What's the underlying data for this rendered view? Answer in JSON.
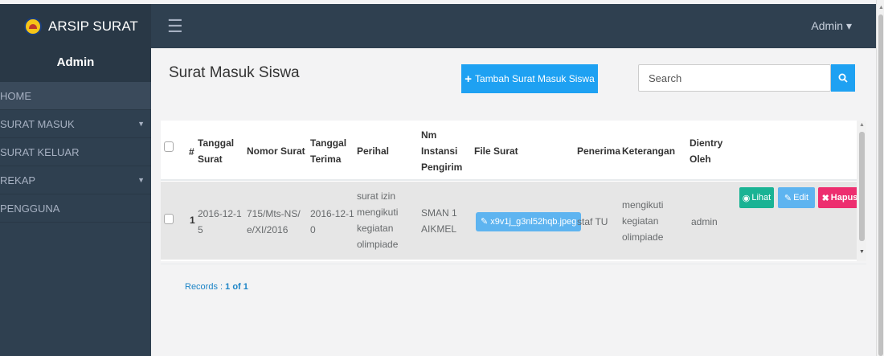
{
  "app": {
    "brand": "ARSIP SURAT",
    "user_menu": "Admin ▾"
  },
  "sidebar": {
    "header": "Admin",
    "items": [
      {
        "label": "HOME"
      },
      {
        "label": "SURAT MASUK"
      },
      {
        "label": "SURAT KELUAR"
      },
      {
        "label": "REKAP"
      },
      {
        "label": "PENGGUNA"
      }
    ]
  },
  "page": {
    "title": "Surat Masuk Siswa",
    "add_button": "Tambah Surat Masuk Siswa",
    "search_placeholder": "Search"
  },
  "table": {
    "headers": {
      "num": "#",
      "tanggal_surat": "Tanggal Surat",
      "nomor_surat": "Nomor Surat",
      "tanggal_terima": "Tanggal Terima",
      "perihal": "Perihal",
      "instansi": "Nm Instansi Pengirim",
      "file": "File Surat",
      "penerima": "Penerima",
      "keterangan": "Keterangan",
      "dientry": "Dientry Oleh"
    },
    "rows": [
      {
        "num": "1",
        "tanggal_surat": "2016-12-15",
        "nomor_surat": "715/Mts-NS/e/XI/2016",
        "tanggal_terima": "2016-12-10",
        "perihal": "surat izin mengikuti kegiatan olimpiade",
        "instansi": "SMAN 1 AIKMEL",
        "file": "x9v1j_g3nl52hqb.jpeg",
        "penerima": "staf TU",
        "keterangan": "mengikuti kegiatan olimpiade",
        "dientry": "admin",
        "actions": {
          "lihat": "Lihat",
          "edit": "Edit",
          "hapus": "Hapus"
        }
      }
    ]
  },
  "records": {
    "prefix": "Records : ",
    "value": "1 of 1"
  },
  "colors": {
    "sidebar": "#2f4050",
    "primary": "#1ea1f2",
    "success": "#1ab394",
    "danger": "#ed2e6f"
  }
}
